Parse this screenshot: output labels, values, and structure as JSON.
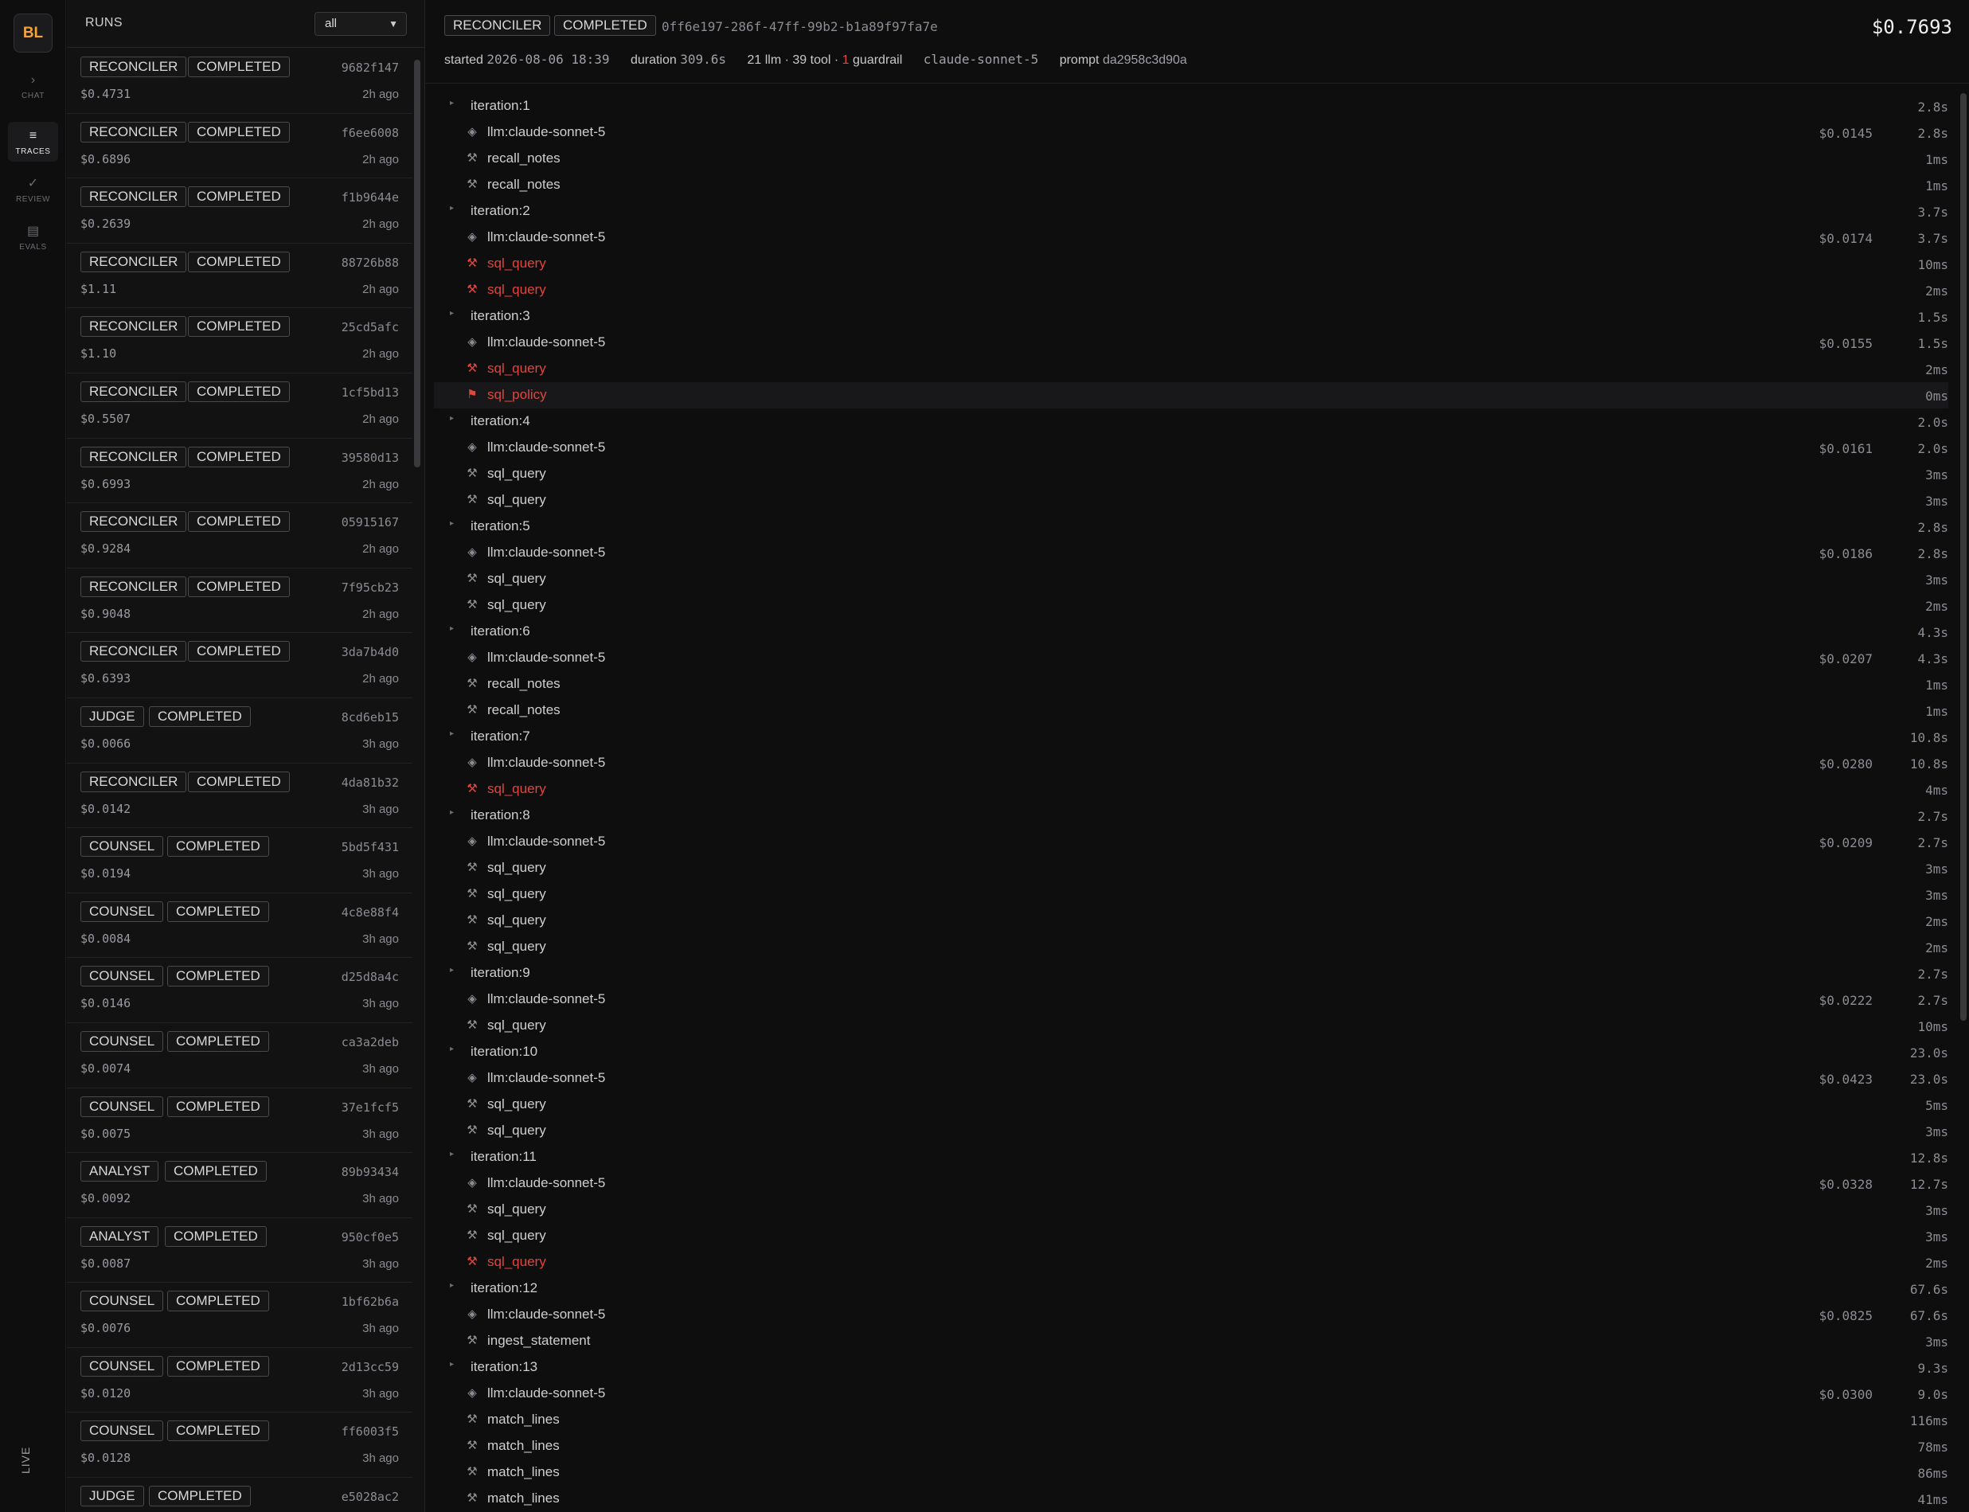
{
  "nav": {
    "logo": "BL",
    "items": [
      {
        "icon": "›",
        "label": "CHAT"
      },
      {
        "icon": "≡",
        "label": "TRACES"
      },
      {
        "icon": "✓",
        "label": "REVIEW"
      },
      {
        "icon": "▤",
        "label": "EVALS"
      }
    ],
    "live": "LIVE"
  },
  "runs": {
    "title": "RUNS",
    "filter": "all",
    "items": [
      {
        "agent": "RECONCILER",
        "status": "COMPLETED",
        "id": "9682f147",
        "cost": "$0.4731",
        "time": "2h ago"
      },
      {
        "agent": "RECONCILER",
        "status": "COMPLETED",
        "id": "f6ee6008",
        "cost": "$0.6896",
        "time": "2h ago"
      },
      {
        "agent": "RECONCILER",
        "status": "COMPLETED",
        "id": "f1b9644e",
        "cost": "$0.2639",
        "time": "2h ago"
      },
      {
        "agent": "RECONCILER",
        "status": "COMPLETED",
        "id": "88726b88",
        "cost": "$1.11",
        "time": "2h ago"
      },
      {
        "agent": "RECONCILER",
        "status": "COMPLETED",
        "id": "25cd5afc",
        "cost": "$1.10",
        "time": "2h ago"
      },
      {
        "agent": "RECONCILER",
        "status": "COMPLETED",
        "id": "1cf5bd13",
        "cost": "$0.5507",
        "time": "2h ago"
      },
      {
        "agent": "RECONCILER",
        "status": "COMPLETED",
        "id": "39580d13",
        "cost": "$0.6993",
        "time": "2h ago"
      },
      {
        "agent": "RECONCILER",
        "status": "COMPLETED",
        "id": "05915167",
        "cost": "$0.9284",
        "time": "2h ago"
      },
      {
        "agent": "RECONCILER",
        "status": "COMPLETED",
        "id": "7f95cb23",
        "cost": "$0.9048",
        "time": "2h ago"
      },
      {
        "agent": "RECONCILER",
        "status": "COMPLETED",
        "id": "3da7b4d0",
        "cost": "$0.6393",
        "time": "2h ago"
      },
      {
        "agent": "JUDGE",
        "status": "COMPLETED",
        "id": "8cd6eb15",
        "cost": "$0.0066",
        "time": "3h ago"
      },
      {
        "agent": "RECONCILER",
        "status": "COMPLETED",
        "id": "4da81b32",
        "cost": "$0.0142",
        "time": "3h ago"
      },
      {
        "agent": "COUNSEL",
        "status": "COMPLETED",
        "id": "5bd5f431",
        "cost": "$0.0194",
        "time": "3h ago"
      },
      {
        "agent": "COUNSEL",
        "status": "COMPLETED",
        "id": "4c8e88f4",
        "cost": "$0.0084",
        "time": "3h ago"
      },
      {
        "agent": "COUNSEL",
        "status": "COMPLETED",
        "id": "d25d8a4c",
        "cost": "$0.0146",
        "time": "3h ago"
      },
      {
        "agent": "COUNSEL",
        "status": "COMPLETED",
        "id": "ca3a2deb",
        "cost": "$0.0074",
        "time": "3h ago"
      },
      {
        "agent": "COUNSEL",
        "status": "COMPLETED",
        "id": "37e1fcf5",
        "cost": "$0.0075",
        "time": "3h ago"
      },
      {
        "agent": "ANALYST",
        "status": "COMPLETED",
        "id": "89b93434",
        "cost": "$0.0092",
        "time": "3h ago"
      },
      {
        "agent": "ANALYST",
        "status": "COMPLETED",
        "id": "950cf0e5",
        "cost": "$0.0087",
        "time": "3h ago"
      },
      {
        "agent": "COUNSEL",
        "status": "COMPLETED",
        "id": "1bf62b6a",
        "cost": "$0.0076",
        "time": "3h ago"
      },
      {
        "agent": "COUNSEL",
        "status": "COMPLETED",
        "id": "2d13cc59",
        "cost": "$0.0120",
        "time": "3h ago"
      },
      {
        "agent": "COUNSEL",
        "status": "COMPLETED",
        "id": "ff6003f5",
        "cost": "$0.0128",
        "time": "3h ago"
      },
      {
        "agent": "JUDGE",
        "status": "COMPLETED",
        "id": "e5028ac2",
        "cost": "",
        "time": ""
      }
    ]
  },
  "run": {
    "agent": "RECONCILER",
    "status": "COMPLETED",
    "uuid": "0ff6e197-286f-47ff-99b2-b1a89f97fa7e",
    "total_cost": "$0.7693",
    "started_label": "started",
    "started": "2026-08-06 18:39",
    "duration_label": "duration",
    "duration": "309.6s",
    "counts_prefix": "21 llm · 39 tool ·",
    "guardrail_count": "1",
    "guardrail_label": "guardrail",
    "model": "claude-sonnet-5",
    "prompt_label": "prompt",
    "prompt": "da2958c3d90a"
  },
  "spans": [
    {
      "kind": "iteration",
      "name": "iteration:1",
      "duration": "2.8s"
    },
    {
      "kind": "llm",
      "name": "llm:claude-sonnet-5",
      "cost": "$0.0145",
      "duration": "2.8s"
    },
    {
      "kind": "tool",
      "name": "recall_notes",
      "duration": "1ms"
    },
    {
      "kind": "tool",
      "name": "recall_notes",
      "duration": "1ms"
    },
    {
      "kind": "iteration",
      "name": "iteration:2",
      "duration": "3.7s"
    },
    {
      "kind": "llm",
      "name": "llm:claude-sonnet-5",
      "cost": "$0.0174",
      "duration": "3.7s"
    },
    {
      "kind": "tool",
      "name": "sql_query",
      "duration": "10ms",
      "error": true
    },
    {
      "kind": "tool",
      "name": "sql_query",
      "duration": "2ms",
      "error": true
    },
    {
      "kind": "iteration",
      "name": "iteration:3",
      "duration": "1.5s"
    },
    {
      "kind": "llm",
      "name": "llm:claude-sonnet-5",
      "cost": "$0.0155",
      "duration": "1.5s"
    },
    {
      "kind": "tool",
      "name": "sql_query",
      "duration": "2ms",
      "error": true
    },
    {
      "kind": "guardrail",
      "name": "sql_policy",
      "duration": "0ms",
      "error": true,
      "highlight": true
    },
    {
      "kind": "iteration",
      "name": "iteration:4",
      "duration": "2.0s"
    },
    {
      "kind": "llm",
      "name": "llm:claude-sonnet-5",
      "cost": "$0.0161",
      "duration": "2.0s"
    },
    {
      "kind": "tool",
      "name": "sql_query",
      "duration": "3ms"
    },
    {
      "kind": "tool",
      "name": "sql_query",
      "duration": "3ms"
    },
    {
      "kind": "iteration",
      "name": "iteration:5",
      "duration": "2.8s"
    },
    {
      "kind": "llm",
      "name": "llm:claude-sonnet-5",
      "cost": "$0.0186",
      "duration": "2.8s"
    },
    {
      "kind": "tool",
      "name": "sql_query",
      "duration": "3ms"
    },
    {
      "kind": "tool",
      "name": "sql_query",
      "duration": "2ms"
    },
    {
      "kind": "iteration",
      "name": "iteration:6",
      "duration": "4.3s"
    },
    {
      "kind": "llm",
      "name": "llm:claude-sonnet-5",
      "cost": "$0.0207",
      "duration": "4.3s"
    },
    {
      "kind": "tool",
      "name": "recall_notes",
      "duration": "1ms"
    },
    {
      "kind": "tool",
      "name": "recall_notes",
      "duration": "1ms"
    },
    {
      "kind": "iteration",
      "name": "iteration:7",
      "duration": "10.8s"
    },
    {
      "kind": "llm",
      "name": "llm:claude-sonnet-5",
      "cost": "$0.0280",
      "duration": "10.8s"
    },
    {
      "kind": "tool",
      "name": "sql_query",
      "duration": "4ms",
      "error": true
    },
    {
      "kind": "iteration",
      "name": "iteration:8",
      "duration": "2.7s"
    },
    {
      "kind": "llm",
      "name": "llm:claude-sonnet-5",
      "cost": "$0.0209",
      "duration": "2.7s"
    },
    {
      "kind": "tool",
      "name": "sql_query",
      "duration": "3ms"
    },
    {
      "kind": "tool",
      "name": "sql_query",
      "duration": "3ms"
    },
    {
      "kind": "tool",
      "name": "sql_query",
      "duration": "2ms"
    },
    {
      "kind": "tool",
      "name": "sql_query",
      "duration": "2ms"
    },
    {
      "kind": "iteration",
      "name": "iteration:9",
      "duration": "2.7s"
    },
    {
      "kind": "llm",
      "name": "llm:claude-sonnet-5",
      "cost": "$0.0222",
      "duration": "2.7s"
    },
    {
      "kind": "tool",
      "name": "sql_query",
      "duration": "10ms"
    },
    {
      "kind": "iteration",
      "name": "iteration:10",
      "duration": "23.0s"
    },
    {
      "kind": "llm",
      "name": "llm:claude-sonnet-5",
      "cost": "$0.0423",
      "duration": "23.0s"
    },
    {
      "kind": "tool",
      "name": "sql_query",
      "duration": "5ms"
    },
    {
      "kind": "tool",
      "name": "sql_query",
      "duration": "3ms"
    },
    {
      "kind": "iteration",
      "name": "iteration:11",
      "duration": "12.8s"
    },
    {
      "kind": "llm",
      "name": "llm:claude-sonnet-5",
      "cost": "$0.0328",
      "duration": "12.7s"
    },
    {
      "kind": "tool",
      "name": "sql_query",
      "duration": "3ms"
    },
    {
      "kind": "tool",
      "name": "sql_query",
      "duration": "3ms"
    },
    {
      "kind": "tool",
      "name": "sql_query",
      "duration": "2ms",
      "error": true
    },
    {
      "kind": "iteration",
      "name": "iteration:12",
      "duration": "67.6s"
    },
    {
      "kind": "llm",
      "name": "llm:claude-sonnet-5",
      "cost": "$0.0825",
      "duration": "67.6s"
    },
    {
      "kind": "tool",
      "name": "ingest_statement",
      "duration": "3ms"
    },
    {
      "kind": "iteration",
      "name": "iteration:13",
      "duration": "9.3s"
    },
    {
      "kind": "llm",
      "name": "llm:claude-sonnet-5",
      "cost": "$0.0300",
      "duration": "9.0s"
    },
    {
      "kind": "tool",
      "name": "match_lines",
      "duration": "116ms"
    },
    {
      "kind": "tool",
      "name": "match_lines",
      "duration": "78ms"
    },
    {
      "kind": "tool",
      "name": "match_lines",
      "duration": "86ms"
    },
    {
      "kind": "tool",
      "name": "match_lines",
      "duration": "41ms"
    }
  ],
  "icons": {
    "caret": "▸",
    "llm": "◈",
    "tool": "⚒",
    "guardrail": "⚑"
  },
  "colors": {
    "accent": "#f2a33a",
    "error": "#e0453e"
  }
}
